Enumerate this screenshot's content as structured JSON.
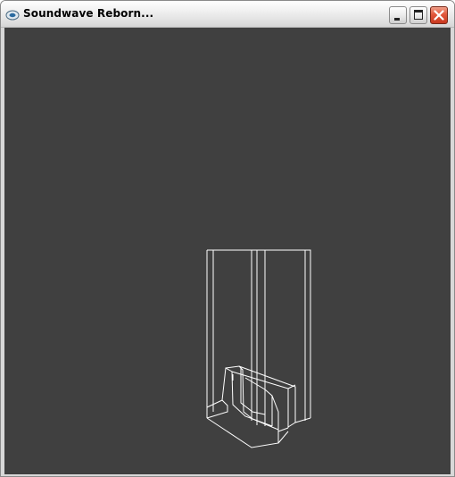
{
  "window": {
    "title": "Soundwave Reborn...",
    "icon": "app-icon",
    "controls": {
      "minimize": "minimize-icon",
      "maximize": "maximize-icon",
      "close": "close-icon"
    }
  },
  "viewport": {
    "background": "#404040",
    "wire_color": "#ffffff"
  }
}
